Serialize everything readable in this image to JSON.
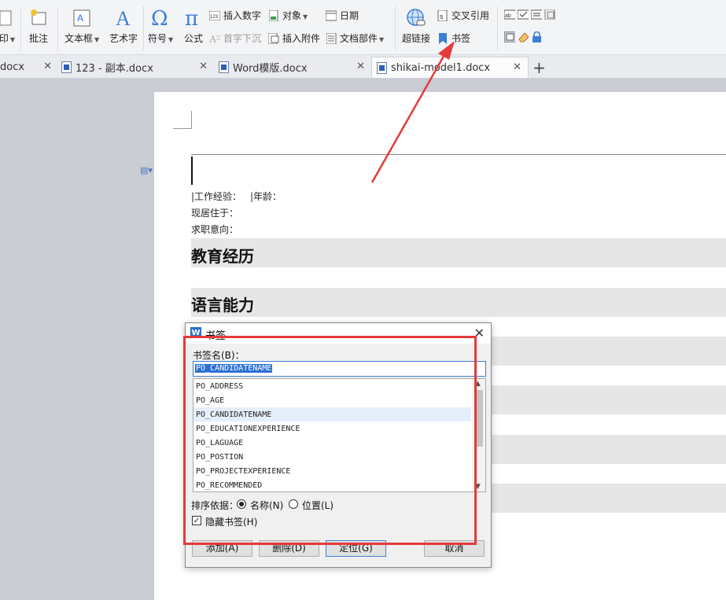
{
  "ribbon": {
    "left_partial": "印",
    "comment": "批注",
    "textbox": "文本框",
    "wordart": "艺术字",
    "symbol": "符号",
    "formula": "公式",
    "insert_number": "插入数字",
    "drop_cap": "首字下沉",
    "object": "对象",
    "insert_attachment": "插入附件",
    "date": "日期",
    "doc_parts": "文档部件",
    "hyperlink": "超链接",
    "cross_reference": "交叉引用",
    "bookmark": "书签"
  },
  "tabs": [
    {
      "label": "docx"
    },
    {
      "label": "123 - 副本.docx"
    },
    {
      "label": "Word模版.docx"
    },
    {
      "label": "shikai-model1.docx"
    }
  ],
  "document": {
    "work_experience": "|工作经验：",
    "age": "|年龄：",
    "current_residence": "现居住于：",
    "job_intention": "求职意向：",
    "heading_education": "教育经历",
    "heading_language": "语言能力"
  },
  "dialog": {
    "logo": "W",
    "title": "书签",
    "name_label": "书签名(B)：",
    "name_value": "PO_CANDIDATENAME",
    "items": [
      "PO_ADDRESS",
      "PO_AGE",
      "PO_CANDIDATENAME",
      "PO_EDUCATIONEXPERIENCE",
      "PO_LAGUAGE",
      "PO_POSTION",
      "PO_PROJECTEXPERIENCE",
      "PO_RECOMMENDED"
    ],
    "selected_index": 2,
    "sort_label": "排序依据：",
    "sort_name": "名称(N)",
    "sort_position": "位置(L)",
    "hide_bookmarks": "隐藏书签(H)",
    "btn_add": "添加(A)",
    "btn_delete": "删除(D)",
    "btn_goto": "定位(G)",
    "btn_cancel": "取消"
  },
  "colors": {
    "accent": "#2b6fd6",
    "annotation": "#e53a3a"
  }
}
